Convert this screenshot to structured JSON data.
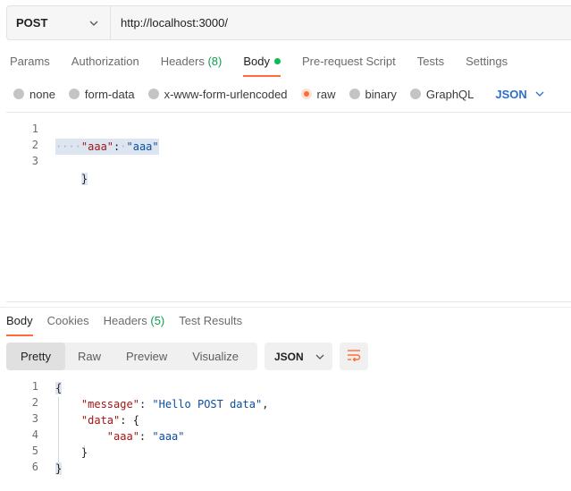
{
  "request": {
    "method": "POST",
    "url": "http://localhost:3000/"
  },
  "request_tabs": [
    {
      "label": "Params"
    },
    {
      "label": "Authorization"
    },
    {
      "label": "Headers",
      "count": "(8)"
    },
    {
      "label": "Body",
      "active": true
    },
    {
      "label": "Pre-request Script"
    },
    {
      "label": "Tests"
    },
    {
      "label": "Settings"
    }
  ],
  "body_types": [
    {
      "label": "none"
    },
    {
      "label": "form-data"
    },
    {
      "label": "x-www-form-urlencoded"
    },
    {
      "label": "raw",
      "checked": true
    },
    {
      "label": "binary"
    },
    {
      "label": "GraphQL"
    }
  ],
  "body_language": "JSON",
  "request_body": {
    "line_numbers": [
      "1",
      "2",
      "3"
    ],
    "open_brace": "{",
    "key": "\"aaa\"",
    "colon": ":",
    "value": "\"aaa\"",
    "close_brace": "}"
  },
  "response_tabs": [
    {
      "label": "Body",
      "active": true
    },
    {
      "label": "Cookies"
    },
    {
      "label": "Headers",
      "count": "(5)"
    },
    {
      "label": "Test Results"
    }
  ],
  "response_views": [
    "Pretty",
    "Raw",
    "Preview",
    "Visualize"
  ],
  "response_format": "JSON",
  "response_body": {
    "line_numbers": [
      "1",
      "2",
      "3",
      "4",
      "5",
      "6"
    ],
    "open_brace": "{",
    "message_key": "\"message\"",
    "message_value": "\"Hello POST data\"",
    "data_key": "\"data\"",
    "inner_key": "\"aaa\"",
    "inner_value": "\"aaa\"",
    "inner_close": "}",
    "close_brace": "}"
  },
  "colors": {
    "accent": "#ff6c37",
    "link": "#2c6fce",
    "success_dot": "#0cbb52",
    "count": "#0d9e4f"
  },
  "icons": [
    "chevron-down-icon",
    "wrap-lines-icon"
  ]
}
